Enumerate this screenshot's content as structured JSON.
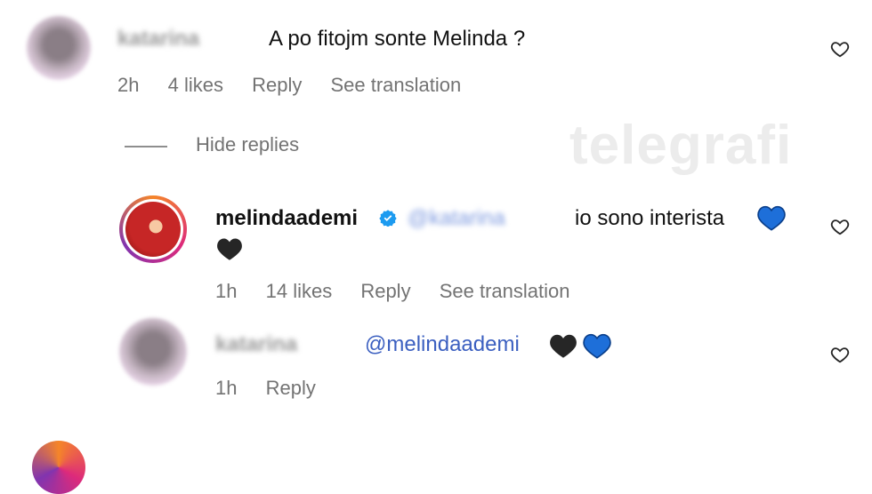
{
  "watermark": "telegrafi",
  "comment1": {
    "username": "katarina",
    "text": "A po fitojm sonte Melinda ?",
    "time": "2h",
    "likes": "4 likes",
    "reply": "Reply",
    "translate": "See translation"
  },
  "hide_replies": "Hide replies",
  "reply1": {
    "username": "melindaademi",
    "mention": "@katarina",
    "text": "io sono interista",
    "time": "1h",
    "likes": "14 likes",
    "reply": "Reply",
    "translate": "See translation"
  },
  "reply2": {
    "username": "katarina",
    "mention": "@melindaademi",
    "time": "1h",
    "reply": "Reply"
  },
  "colors": {
    "blue_heart": "#1e6fd9",
    "black_heart": "#262626",
    "verified": "#1d9bf0"
  }
}
